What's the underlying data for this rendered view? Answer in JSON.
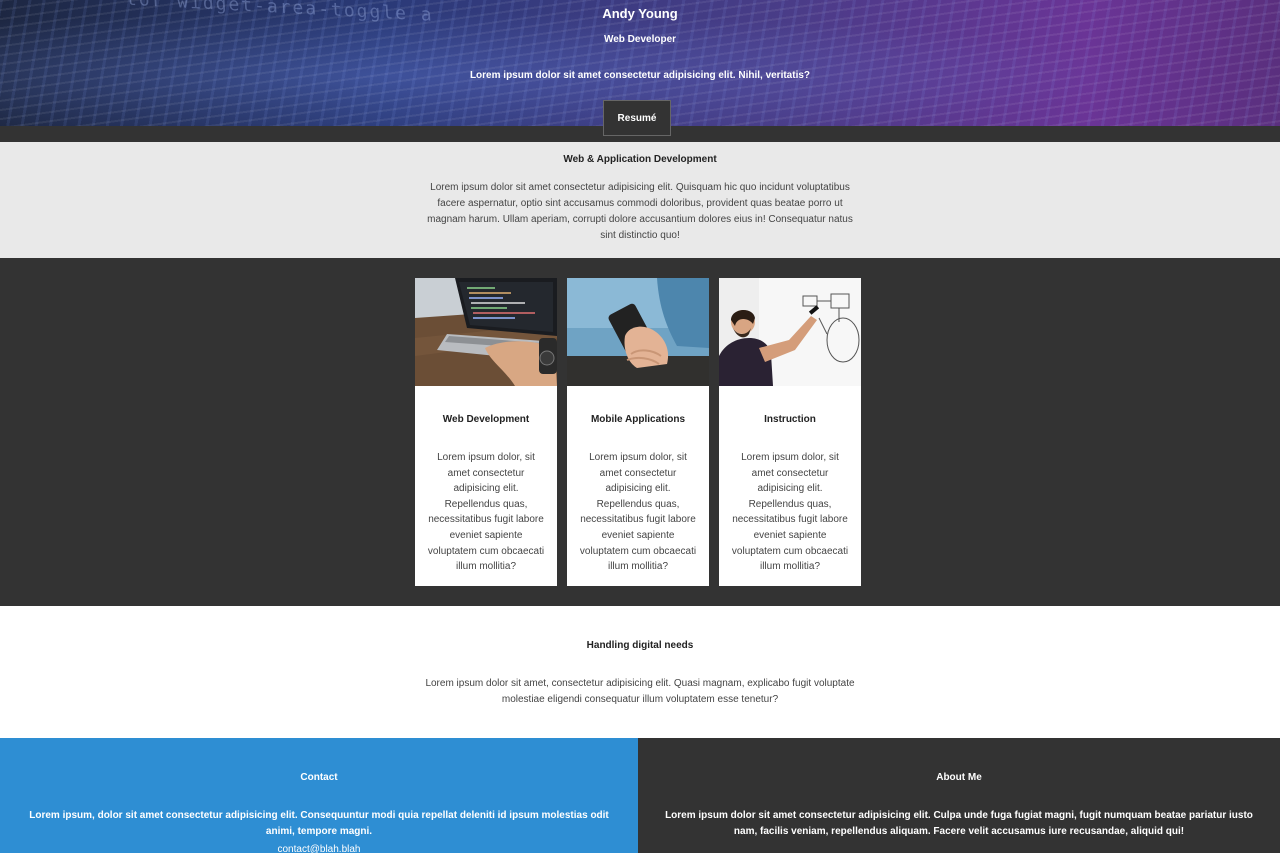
{
  "hero": {
    "name": "Andy Young",
    "title": "Web Developer",
    "tagline": "Lorem ipsum dolor sit amet consectetur adipisicing elit. Nihil, veritatis?",
    "resume_label": "Resumé",
    "bg_code_text": "--tor widget-area-toggle a"
  },
  "intro": {
    "heading": "Web & Application Development",
    "text": "Lorem ipsum dolor sit amet consectetur adipisicing elit. Quisquam hic quo incidunt voluptatibus facere aspernatur, optio sint accusamus commodi doloribus, provident quas beatae porro ut magnam harum. Ullam aperiam, corrupti dolore accusantium dolores eius in! Consequatur natus sint distinctio quo!"
  },
  "services": [
    {
      "title": "Web Development",
      "text": "Lorem ipsum dolor, sit amet consectetur adipisicing elit. Repellendus quas, necessitatibus fugit labore eveniet sapiente voluptatem cum obcaecati illum mollitia?",
      "image": "laptop-coding-photo"
    },
    {
      "title": "Mobile Applications",
      "text": "Lorem ipsum dolor, sit amet consectetur adipisicing elit. Repellendus quas, necessitatibus fugit labore eveniet sapiente voluptatem cum obcaecati illum mollitia?",
      "image": "hand-holding-phone-photo"
    },
    {
      "title": "Instruction",
      "text": "Lorem ipsum dolor, sit amet consectetur adipisicing elit. Repellendus quas, necessitatibus fugit labore eveniet sapiente voluptatem cum obcaecati illum mollitia?",
      "image": "man-at-whiteboard-photo"
    }
  ],
  "needs": {
    "heading": "Handling digital needs",
    "text": "Lorem ipsum dolor sit amet, consectetur adipisicing elit. Quasi magnam, explicabo fugit voluptate molestiae eligendi consequatur illum voluptatem esse tenetur?"
  },
  "contact": {
    "heading": "Contact",
    "text": "Lorem ipsum, dolor sit amet consectetur adipisicing elit. Consequuntur modi quia repellat deleniti id ipsum molestias odit animi, tempore magni.",
    "email": "contact@blah.blah"
  },
  "about": {
    "heading": "About Me",
    "text": "Lorem ipsum dolor sit amet consectetur adipisicing elit. Culpa unde fuga fugiat magni, fugit numquam beatae pariatur iusto nam, facilis veniam, repellendus aliquam. Facere velit accusamus iure recusandae, aliquid qui!"
  },
  "colors": {
    "dark": "#333333",
    "light_gray": "#e9e9e9",
    "contact_blue": "#2e8ed3"
  }
}
